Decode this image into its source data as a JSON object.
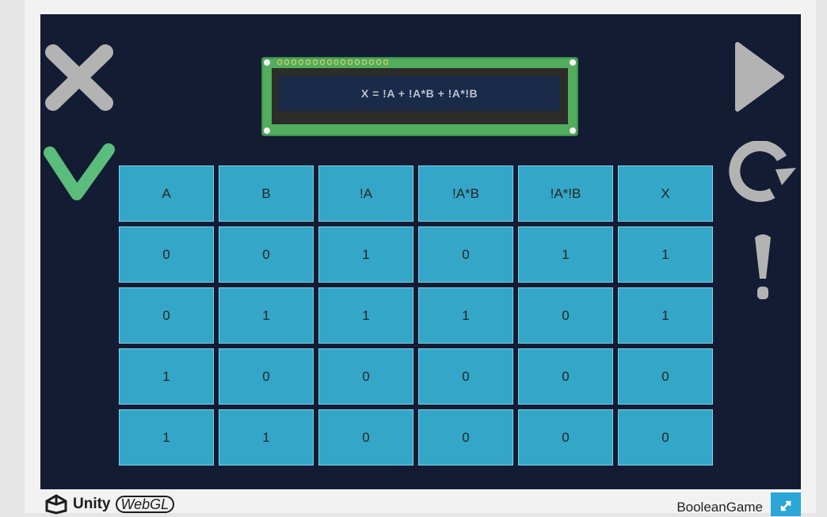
{
  "lcd": {
    "expression": "X = !A + !A*B + !A*!B"
  },
  "table": {
    "headers": [
      "A",
      "B",
      "!A",
      "!A*B",
      "!A*!B",
      "X"
    ],
    "rows": [
      [
        "0",
        "0",
        "1",
        "0",
        "1",
        "1"
      ],
      [
        "0",
        "1",
        "1",
        "1",
        "0",
        "1"
      ],
      [
        "1",
        "0",
        "0",
        "0",
        "0",
        "0"
      ],
      [
        "1",
        "1",
        "0",
        "0",
        "0",
        "0"
      ]
    ]
  },
  "controls": {
    "close": "close-icon",
    "check": "checkmark-icon",
    "play": "play-icon",
    "restart": "restart-icon",
    "hint": "exclamation-icon"
  },
  "footer": {
    "brand": "Unity",
    "webgl": "WebGL",
    "game_title": "BooleanGame"
  },
  "colors": {
    "background": "#131c33",
    "cell": "#34a6c8",
    "check": "#5bbd7c",
    "icon_gray": "#b3b3b3",
    "lcd_board": "#52ad5d"
  }
}
